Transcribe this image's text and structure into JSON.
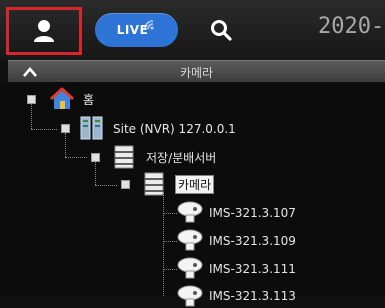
{
  "toolbar": {
    "live_label": "LIVE",
    "datetime": "2020-"
  },
  "panel": {
    "title": "카메라"
  },
  "tree": {
    "root_label": "홈",
    "site_label": "Site (NVR) 127.0.0.1",
    "storage_label": "저장/분배서버",
    "camera_group_label": "카메라",
    "cameras": [
      "IMS-321.3.107",
      "IMS-321.3.109",
      "IMS-321.3.111",
      "IMS-321.3.113"
    ]
  },
  "colors": {
    "selection_border": "#d8262c",
    "live_button": "#2d74d6",
    "panel_header": "#4a4a4a"
  },
  "icons": {
    "user": "user-icon",
    "wifi": "signal-icon",
    "search": "search-icon",
    "collapse": "chevron-up-icon",
    "home": "home-icon",
    "nvr": "server-icon",
    "storage": "storage-server-icon",
    "camera_group": "camera-group-icon",
    "camera": "camera-icon"
  }
}
